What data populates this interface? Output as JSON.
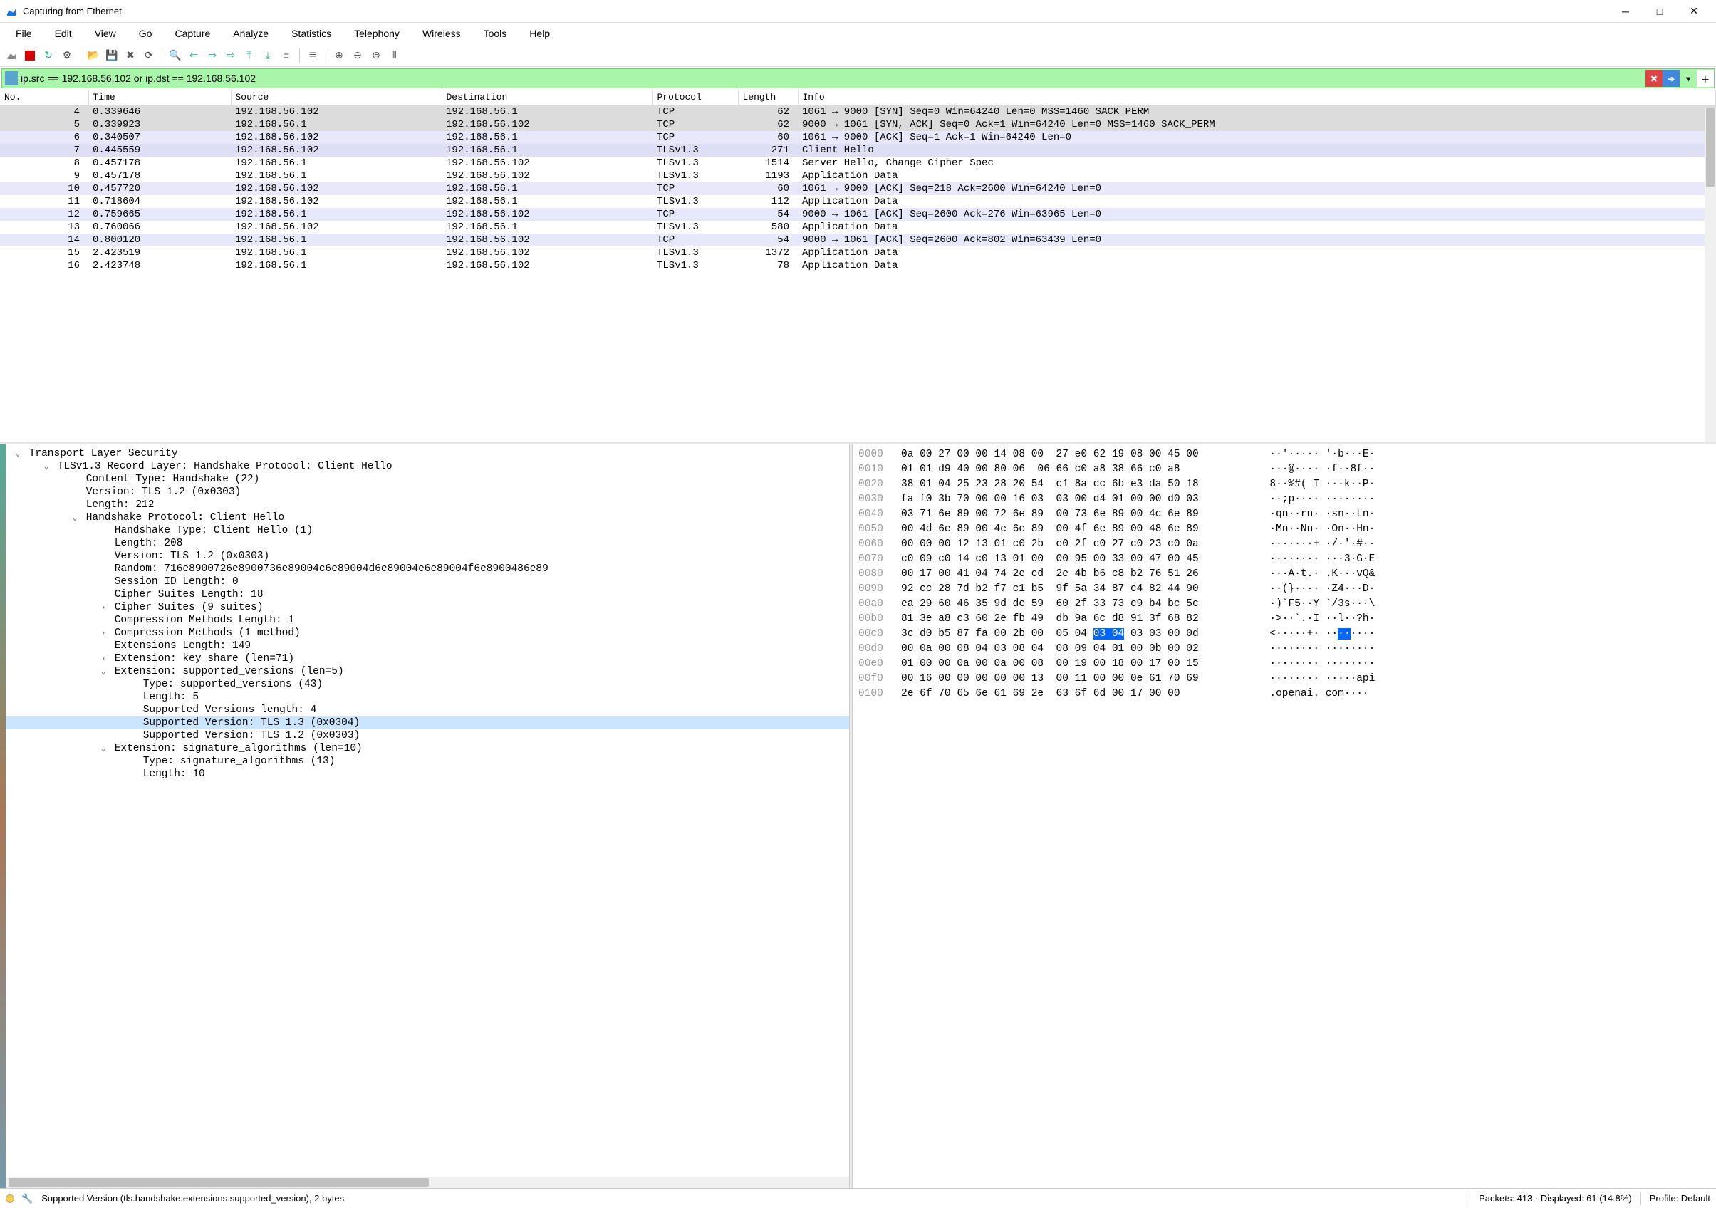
{
  "window": {
    "title": "Capturing from Ethernet"
  },
  "menu": [
    "File",
    "Edit",
    "View",
    "Go",
    "Capture",
    "Analyze",
    "Statistics",
    "Telephony",
    "Wireless",
    "Tools",
    "Help"
  ],
  "filter": {
    "value": "ip.src == 192.168.56.102 or ip.dst == 192.168.56.102"
  },
  "columns": [
    "No.",
    "Time",
    "Source",
    "Destination",
    "Protocol",
    "Length",
    "Info"
  ],
  "packets": [
    {
      "no": "4",
      "time": "0.339646",
      "src": "192.168.56.102",
      "dst": "192.168.56.1",
      "proto": "TCP",
      "len": "62",
      "info": "1061 → 9000 [SYN] Seq=0 Win=64240 Len=0 MSS=1460 SACK_PERM",
      "cls": "row-gray"
    },
    {
      "no": "5",
      "time": "0.339923",
      "src": "192.168.56.1",
      "dst": "192.168.56.102",
      "proto": "TCP",
      "len": "62",
      "info": "9000 → 1061 [SYN, ACK] Seq=0 Ack=1 Win=64240 Len=0 MSS=1460 SACK_PERM",
      "cls": "row-gray"
    },
    {
      "no": "6",
      "time": "0.340507",
      "src": "192.168.56.102",
      "dst": "192.168.56.1",
      "proto": "TCP",
      "len": "60",
      "info": "1061 → 9000 [ACK] Seq=1 Ack=1 Win=64240 Len=0",
      "cls": "row-lav"
    },
    {
      "no": "7",
      "time": "0.445559",
      "src": "192.168.56.102",
      "dst": "192.168.56.1",
      "proto": "TLSv1.3",
      "len": "271",
      "info": "Client Hello",
      "cls": "row-lav2"
    },
    {
      "no": "8",
      "time": "0.457178",
      "src": "192.168.56.1",
      "dst": "192.168.56.102",
      "proto": "TLSv1.3",
      "len": "1514",
      "info": "Server Hello, Change Cipher Spec",
      "cls": "row-white"
    },
    {
      "no": "9",
      "time": "0.457178",
      "src": "192.168.56.1",
      "dst": "192.168.56.102",
      "proto": "TLSv1.3",
      "len": "1193",
      "info": "Application Data",
      "cls": "row-white"
    },
    {
      "no": "10",
      "time": "0.457720",
      "src": "192.168.56.102",
      "dst": "192.168.56.1",
      "proto": "TCP",
      "len": "60",
      "info": "1061 → 9000 [ACK] Seq=218 Ack=2600 Win=64240 Len=0",
      "cls": "row-lav"
    },
    {
      "no": "11",
      "time": "0.718604",
      "src": "192.168.56.102",
      "dst": "192.168.56.1",
      "proto": "TLSv1.3",
      "len": "112",
      "info": "Application Data",
      "cls": "row-white"
    },
    {
      "no": "12",
      "time": "0.759665",
      "src": "192.168.56.1",
      "dst": "192.168.56.102",
      "proto": "TCP",
      "len": "54",
      "info": "9000 → 1061 [ACK] Seq=2600 Ack=276 Win=63965 Len=0",
      "cls": "row-lav"
    },
    {
      "no": "13",
      "time": "0.760066",
      "src": "192.168.56.102",
      "dst": "192.168.56.1",
      "proto": "TLSv1.3",
      "len": "580",
      "info": "Application Data",
      "cls": "row-white"
    },
    {
      "no": "14",
      "time": "0.800120",
      "src": "192.168.56.1",
      "dst": "192.168.56.102",
      "proto": "TCP",
      "len": "54",
      "info": "9000 → 1061 [ACK] Seq=2600 Ack=802 Win=63439 Len=0",
      "cls": "row-lav"
    },
    {
      "no": "15",
      "time": "2.423519",
      "src": "192.168.56.1",
      "dst": "192.168.56.102",
      "proto": "TLSv1.3",
      "len": "1372",
      "info": "Application Data",
      "cls": "row-white"
    },
    {
      "no": "16",
      "time": "2.423748",
      "src": "192.168.56.1",
      "dst": "192.168.56.102",
      "proto": "TLSv1.3",
      "len": "78",
      "info": "Application Data",
      "cls": "row-white"
    }
  ],
  "tree": [
    {
      "indent": 0,
      "caret": "v",
      "text": "Transport Layer Security"
    },
    {
      "indent": 1,
      "caret": "v",
      "text": "TLSv1.3 Record Layer: Handshake Protocol: Client Hello"
    },
    {
      "indent": 2,
      "caret": "",
      "text": "Content Type: Handshake (22)"
    },
    {
      "indent": 2,
      "caret": "",
      "text": "Version: TLS 1.2 (0x0303)"
    },
    {
      "indent": 2,
      "caret": "",
      "text": "Length: 212"
    },
    {
      "indent": 2,
      "caret": "v",
      "text": "Handshake Protocol: Client Hello"
    },
    {
      "indent": 3,
      "caret": "",
      "text": "Handshake Type: Client Hello (1)"
    },
    {
      "indent": 3,
      "caret": "",
      "text": "Length: 208"
    },
    {
      "indent": 3,
      "caret": "",
      "text": "Version: TLS 1.2 (0x0303)"
    },
    {
      "indent": 3,
      "caret": "",
      "text": "Random: 716e8900726e8900736e89004c6e89004d6e89004e6e89004f6e8900486e89"
    },
    {
      "indent": 3,
      "caret": "",
      "text": "Session ID Length: 0"
    },
    {
      "indent": 3,
      "caret": "",
      "text": "Cipher Suites Length: 18"
    },
    {
      "indent": 3,
      "caret": ">",
      "text": "Cipher Suites (9 suites)"
    },
    {
      "indent": 3,
      "caret": "",
      "text": "Compression Methods Length: 1"
    },
    {
      "indent": 3,
      "caret": ">",
      "text": "Compression Methods (1 method)"
    },
    {
      "indent": 3,
      "caret": "",
      "text": "Extensions Length: 149"
    },
    {
      "indent": 3,
      "caret": ">",
      "text": "Extension: key_share (len=71)"
    },
    {
      "indent": 3,
      "caret": "v",
      "text": "Extension: supported_versions (len=5)"
    },
    {
      "indent": 4,
      "caret": "",
      "text": "Type: supported_versions (43)"
    },
    {
      "indent": 4,
      "caret": "",
      "text": "Length: 5"
    },
    {
      "indent": 4,
      "caret": "",
      "text": "Supported Versions length: 4"
    },
    {
      "indent": 4,
      "caret": "",
      "text": "Supported Version: TLS 1.3 (0x0304)",
      "sel": true
    },
    {
      "indent": 4,
      "caret": "",
      "text": "Supported Version: TLS 1.2 (0x0303)"
    },
    {
      "indent": 3,
      "caret": "v",
      "text": "Extension: signature_algorithms (len=10)"
    },
    {
      "indent": 4,
      "caret": "",
      "text": "Type: signature_algorithms (13)"
    },
    {
      "indent": 4,
      "caret": "",
      "text": "Length: 10"
    }
  ],
  "hex": [
    {
      "off": "0000",
      "h1": "0a 00 27 00 00 14 08 00",
      "h2": "27 e0 62 19 08 00 45 00",
      "a": "··'····· '·b···E·"
    },
    {
      "off": "0010",
      "h1": "01 01 d9 40 00 80 06",
      "h2": "06 66 c0 a8 38 66 c0 a8",
      "a": "···@···· ·f··8f··"
    },
    {
      "off": "0020",
      "h1": "38 01 04 25 23 28 20 54",
      "h2": "c1 8a cc 6b e3 da 50 18",
      "a": "8··%#( T ···k··P·"
    },
    {
      "off": "0030",
      "h1": "fa f0 3b 70 00 00 16 03",
      "h2": "03 00 d4 01 00 00 d0 03",
      "a": "··;p···· ········"
    },
    {
      "off": "0040",
      "h1": "03 71 6e 89 00 72 6e 89",
      "h2": "00 73 6e 89 00 4c 6e 89",
      "a": "·qn··rn· ·sn··Ln·"
    },
    {
      "off": "0050",
      "h1": "00 4d 6e 89 00 4e 6e 89",
      "h2": "00 4f 6e 89 00 48 6e 89",
      "a": "·Mn··Nn· ·On··Hn·"
    },
    {
      "off": "0060",
      "h1": "00 00 00 12 13 01 c0 2b",
      "h2": "c0 2f c0 27 c0 23 c0 0a",
      "a": "·······+ ·/·'·#··"
    },
    {
      "off": "0070",
      "h1": "c0 09 c0 14 c0 13 01 00",
      "h2": "00 95 00 33 00 47 00 45",
      "a": "········ ···3·G·E"
    },
    {
      "off": "0080",
      "h1": "00 17 00 41 04 74 2e cd",
      "h2": "2e 4b b6 c8 b2 76 51 26",
      "a": "···A·t.· .K···vQ&"
    },
    {
      "off": "0090",
      "h1": "92 cc 28 7d b2 f7 c1 b5",
      "h2": "9f 5a 34 87 c4 82 44 90",
      "a": "··(}···· ·Z4···D·"
    },
    {
      "off": "00a0",
      "h1": "ea 29 60 46 35 9d dc 59",
      "h2": "60 2f 33 73 c9 b4 bc 5c",
      "a": "·)`F5··Y `/3s···\\"
    },
    {
      "off": "00b0",
      "h1": "81 3e a8 c3 60 2e fb 49",
      "h2": "db 9a 6c d8 91 3f 68 82",
      "a": "·>··`.·I ··l··?h·"
    },
    {
      "off": "00c0",
      "h1": "3c d0 b5 87 fa 00 2b 00",
      "h2": "05 04 ",
      "h2hl": "03 04",
      "h2t": " 03 03 00 0d",
      "a": "<·····+· ··",
      "ahl": "··",
      "at": "····"
    },
    {
      "off": "00d0",
      "h1": "00 0a 00 08 04 03 08 04",
      "h2": "08 09 04 01 00 0b 00 02",
      "a": "········ ········"
    },
    {
      "off": "00e0",
      "h1": "01 00 00 0a 00 0a 00 08",
      "h2": "00 19 00 18 00 17 00 15",
      "a": "········ ········"
    },
    {
      "off": "00f0",
      "h1": "00 16 00 00 00 00 00 13",
      "h2": "00 11 00 00 0e 61 70 69",
      "a": "········ ·····api"
    },
    {
      "off": "0100",
      "h1": "2e 6f 70 65 6e 61 69 2e",
      "h2": "63 6f 6d 00 17 00 00",
      "a": ".openai. com····"
    }
  ],
  "status": {
    "field": "Supported Version (tls.handshake.extensions.supported_version), 2 bytes",
    "packets": "Packets: 413 · Displayed: 61 (14.8%)",
    "profile": "Profile: Default"
  }
}
